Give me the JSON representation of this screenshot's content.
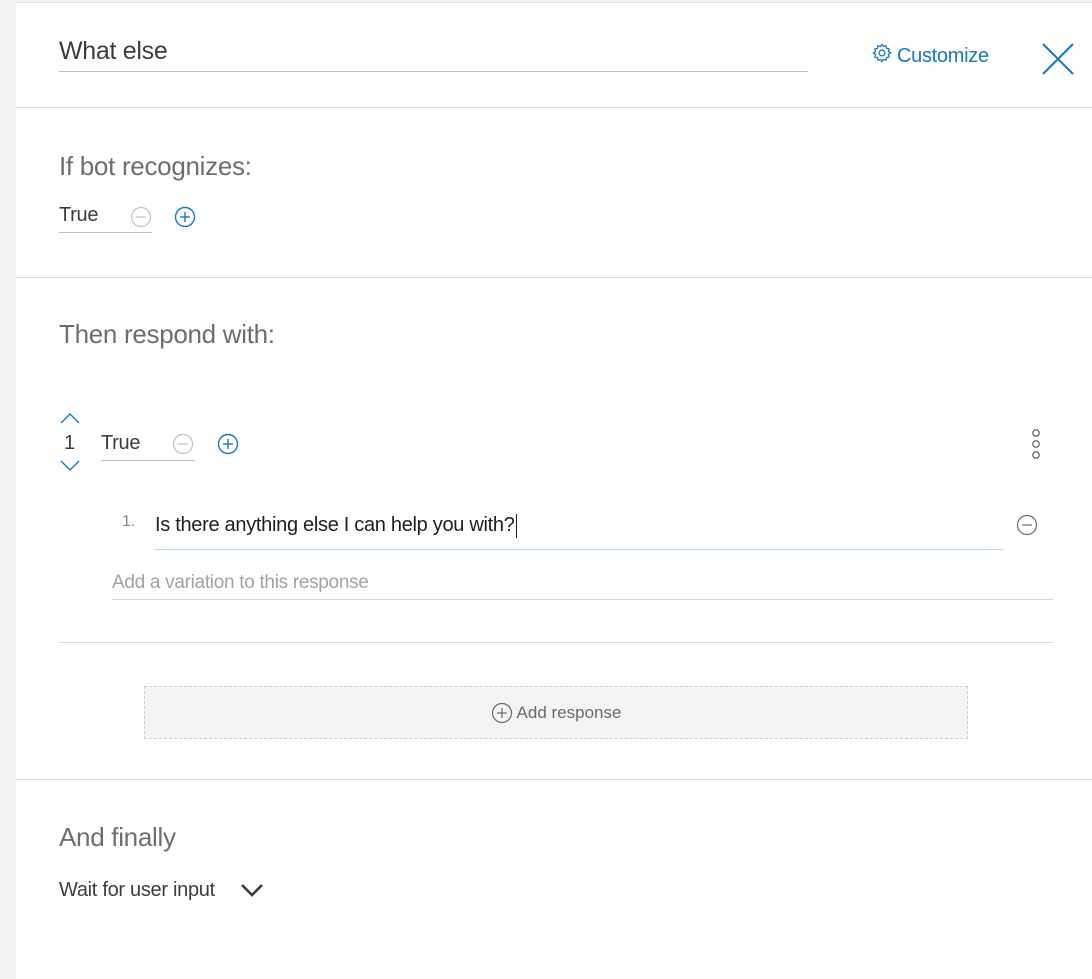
{
  "header": {
    "node_title": "What else",
    "customize_label": "Customize"
  },
  "condition_section": {
    "heading": "If bot recognizes:",
    "condition_value": "True"
  },
  "response_section": {
    "heading": "Then respond with:",
    "responses": [
      {
        "index": "1",
        "condition_value": "True",
        "variations": [
          {
            "number": "1.",
            "text": "Is there anything else I can help you with?"
          }
        ],
        "variation_placeholder": "Add a variation to this response"
      }
    ],
    "add_response_label": "Add response"
  },
  "finally_section": {
    "heading": "And finally",
    "selected_action": "Wait for user input"
  },
  "colors": {
    "accent": "#1b78b8",
    "text": "#3d3d3d",
    "muted": "#6e6e6e",
    "placeholder": "#a3a3a3"
  }
}
